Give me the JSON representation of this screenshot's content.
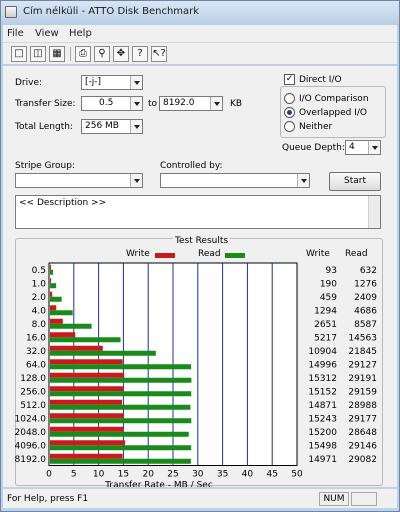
{
  "window": {
    "title": "Cím nélküli - ATTO Disk Benchmark"
  },
  "menu": {
    "file": "File",
    "view": "View",
    "help": "Help"
  },
  "toolbar": [
    "new-icon",
    "open-icon",
    "save-icon",
    "print-icon",
    "print-preview-icon",
    "move-icon",
    "help-icon",
    "context-help-icon"
  ],
  "settings": {
    "drive_label": "Drive:",
    "drive_value": "[-j-]",
    "transfer_size_label": "Transfer Size:",
    "transfer_size_from": "0.5",
    "to_label": "to",
    "transfer_size_to": "8192.0",
    "kb_label": "KB",
    "total_length_label": "Total Length:",
    "total_length_value": "256 MB",
    "direct_io_label": "Direct I/O",
    "io_comparison_label": "I/O Comparison",
    "overlapped_io_label": "Overlapped I/O",
    "neither_label": "Neither",
    "queue_depth_label": "Queue Depth:",
    "queue_depth_value": "4",
    "stripe_group_label": "Stripe Group:",
    "controlled_by_label": "Controlled by:",
    "start_label": "Start",
    "description": "<< Description >>"
  },
  "results": {
    "title": "Test Results",
    "write_legend": "Write",
    "read_legend": "Read",
    "write_col": "Write",
    "read_col": "Read",
    "write_color": "#cc1a1a",
    "read_color": "#1a8a1a"
  },
  "chart_data": {
    "type": "bar",
    "categories": [
      "0.5",
      "1.0",
      "2.0",
      "4.0",
      "8.0",
      "16.0",
      "32.0",
      "64.0",
      "128.0",
      "256.0",
      "512.0",
      "1024.0",
      "2048.0",
      "4096.0",
      "8192.0"
    ],
    "series": [
      {
        "name": "Write",
        "values": [
          93,
          190,
          459,
          1294,
          2651,
          5217,
          10904,
          14996,
          15312,
          15152,
          14871,
          15243,
          15200,
          15498,
          14971
        ]
      },
      {
        "name": "Read",
        "values": [
          632,
          1276,
          2409,
          4686,
          8587,
          14563,
          21845,
          29127,
          29191,
          29159,
          28988,
          29177,
          28648,
          29146,
          29082
        ]
      }
    ],
    "xlabel": "Transfer Rate - MB / Sec",
    "xticks": [
      "0",
      "5",
      "10",
      "15",
      "20",
      "25",
      "30",
      "35",
      "40",
      "45",
      "50"
    ],
    "xlim": [
      0,
      50
    ],
    "grid": true
  },
  "status": {
    "text": "For Help, press F1",
    "num": "NUM"
  }
}
